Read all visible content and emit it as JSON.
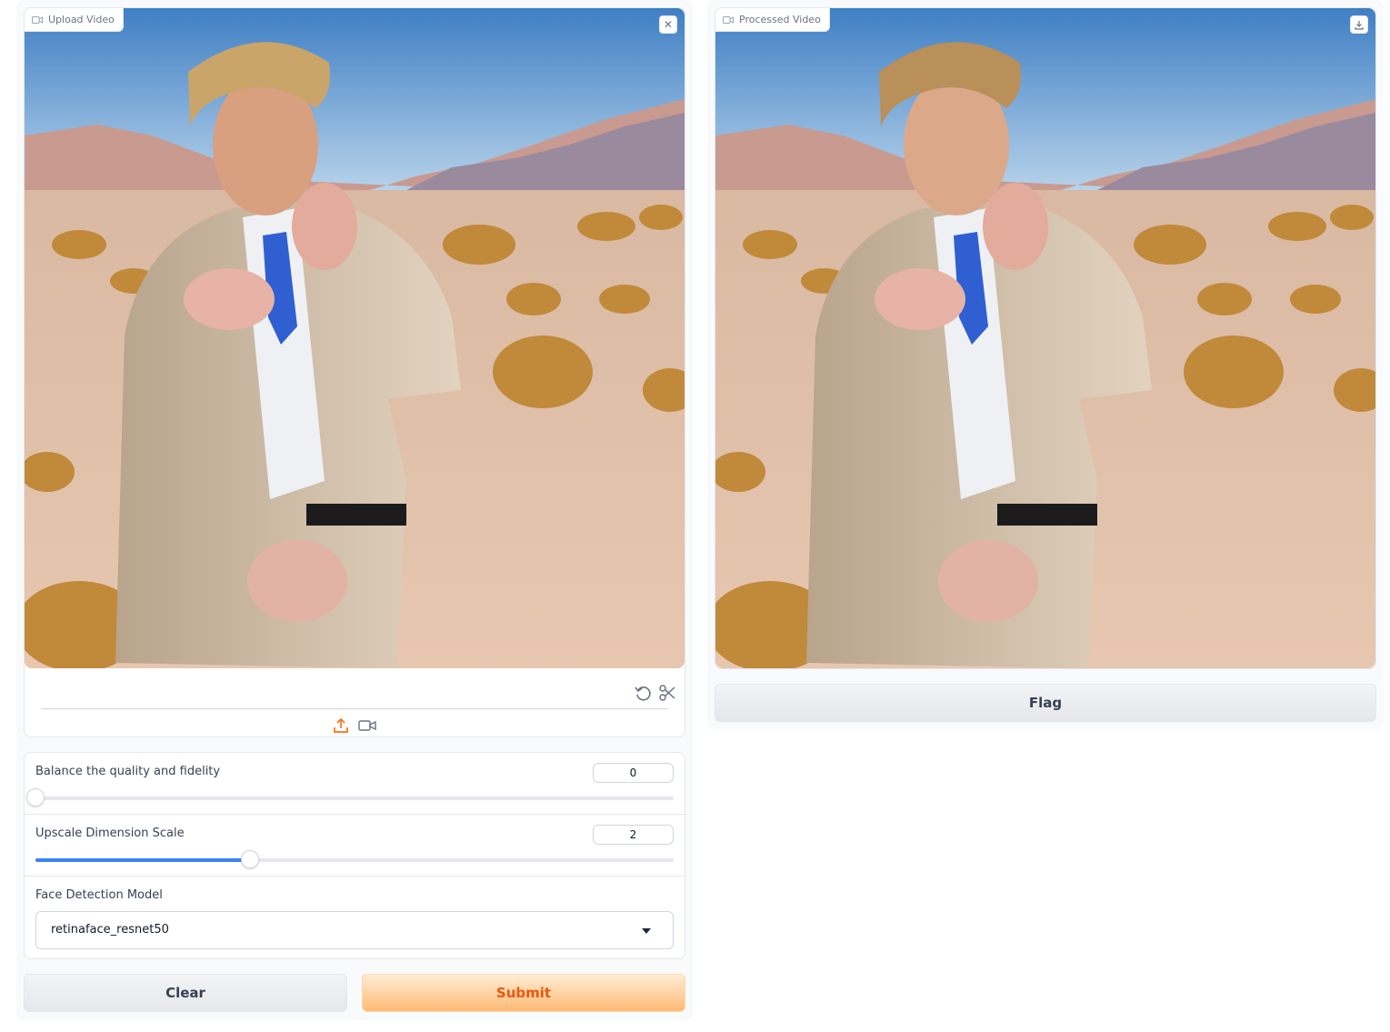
{
  "upload_video": {
    "label": "Upload Video",
    "clear_icon": "close-icon",
    "edit_icons": [
      "undo-icon",
      "scissors-icon"
    ],
    "source_icons": [
      "upload-icon",
      "video-camera-icon"
    ]
  },
  "processed_video": {
    "label": "Processed Video",
    "download_icon": "download-icon"
  },
  "settings": {
    "fidelity": {
      "label": "Balance the quality and fidelity",
      "value": "0",
      "fraction": 0.0
    },
    "upscale": {
      "label": "Upscale Dimension Scale",
      "value": "2",
      "fraction": 0.3357
    },
    "face_model": {
      "label": "Face Detection Model",
      "selected": "retinaface_resnet50"
    }
  },
  "buttons": {
    "clear": "Clear",
    "submit": "Submit",
    "flag": "Flag"
  },
  "colors": {
    "accent": "#3b82f6",
    "primary_text": "#ea580c",
    "upload_icon": "#f97316"
  }
}
